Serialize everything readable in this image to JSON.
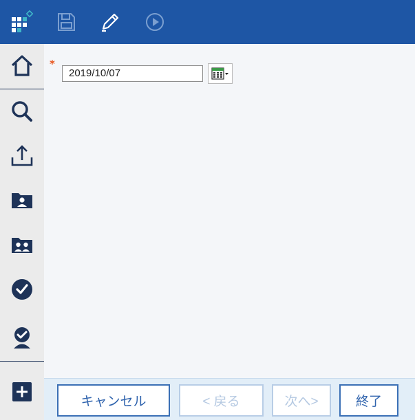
{
  "toolbar": {
    "icons": [
      "app-logo-icon",
      "save-icon",
      "edit-pencil-icon",
      "play-icon"
    ]
  },
  "sidebar": {
    "items": [
      "home-icon",
      "search-icon",
      "upload-icon",
      "folder-user-icon",
      "folder-users-icon",
      "check-circle-icon",
      "user-check-icon",
      "add-icon"
    ]
  },
  "form": {
    "required_mark": "*",
    "date_value": "2019/10/07"
  },
  "footer": {
    "cancel_label": "キャンセル",
    "back_label": "< 戻る",
    "next_label": "次へ>",
    "finish_label": "終了"
  },
  "colors": {
    "topbar": "#1e56a5",
    "accent": "#2f63ad",
    "icon_dark": "#1e3358",
    "required": "#e8541c"
  }
}
